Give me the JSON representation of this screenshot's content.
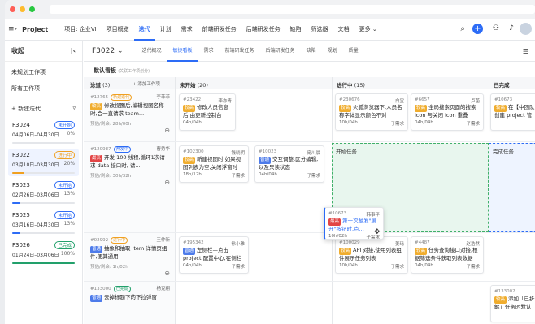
{
  "app": {
    "title": "Project",
    "project": "项目: 企业VI"
  },
  "nav": [
    "项目概览",
    "迭代",
    "计划",
    "需求",
    "前端研发任务",
    "后端研发任务",
    "缺陷",
    "筛选器",
    "文档",
    "更多"
  ],
  "sidebar": {
    "title": "收起",
    "links": [
      "未规划工作项",
      "所有工作项"
    ],
    "new_label": "新建迭代",
    "iterations": [
      {
        "name": "F3024",
        "dates": "04月06日–04月30日",
        "status": "未开始",
        "progress": "0%",
        "color": "#2d6cf6",
        "fill": 0
      },
      {
        "name": "F3022",
        "dates": "03月10日–03月30日",
        "status": "进行中",
        "progress": "20%",
        "color": "#f0a020",
        "fill": 0.2
      },
      {
        "name": "F3023",
        "dates": "02月26日–03月06日",
        "status": "未开始",
        "progress": "13%",
        "color": "#2d6cf6",
        "fill": 0.13
      },
      {
        "name": "F3025",
        "dates": "03月16日–04月30日",
        "status": "未开始",
        "progress": "13%",
        "color": "#2d6cf6",
        "fill": 0.13
      },
      {
        "name": "F3026",
        "dates": "01月24日–03月06日",
        "status": "已完成",
        "progress": "100%",
        "color": "#22a06b",
        "fill": 1
      }
    ]
  },
  "subnav": {
    "current": "F3022",
    "tabs": [
      "迭代概况",
      "敏捷看板",
      "需求",
      "前端研发任务",
      "后端研发任务",
      "缺陷",
      "规划",
      "质量"
    ]
  },
  "board": {
    "title": "默认看板",
    "hint": "(关联工作项划分)",
    "pool": "泳道",
    "pool_count": "(3)",
    "add": "+ 添加工作项",
    "cols": [
      {
        "name": "未开始",
        "count": "(20)"
      },
      {
        "name": "进行中",
        "count": "(15)"
      },
      {
        "name": "已完成",
        "count": ""
      }
    ],
    "lane_headers": [
      {
        "id": "#12765",
        "status": "新建迭代",
        "assignee": "李菲菲",
        "label": "较高",
        "title": "修改视图后,编辑视图名称时,会一直请求 team...",
        "meta": "预估/剩余: 28h/00h"
      },
      {
        "id": "#120987",
        "status": "开发中",
        "assignee": "曹秀华",
        "label": "最高",
        "title": "开发 100 线程,循环1次请求 data 接口时, 请...",
        "meta": "预估/剩余: 30h/32h"
      },
      {
        "id": "#02992",
        "status": "进行中",
        "assignee": "王仲新",
        "label": "普通",
        "title": "抽象和抽取 item 详情页组件,便其通用",
        "meta": "预估/剩余: 1h/02h"
      },
      {
        "id": "#133000",
        "status": "已完成",
        "assignee": "杨克翔",
        "label": "普通",
        "title": "去掉标题下的下拉弹窗",
        "meta": ""
      }
    ],
    "cards": [
      {
        "id": "#23422",
        "assignee": "李亦青",
        "label": "较高",
        "title": "修改人员信息后 由更新控制台",
        "hours": "04h/04h",
        "type": ""
      },
      {
        "id": "#230676",
        "assignee": "白宝",
        "label": "较高",
        "title": "火狐浏览器下,人员名称字体显示颜色不对",
        "hours": "10h/04h",
        "type": "子需求"
      },
      {
        "id": "#6657",
        "assignee": "卢菡",
        "label": "较高",
        "title": "全局搜索页面的搜索 icon 与关闭 icon 重叠",
        "hours": "04h/04h",
        "type": "子需求"
      },
      {
        "id": "#10673",
        "assignee": "",
        "label": "较高",
        "title": "在【中团队创建 project 管 理员权限",
        "hours": "",
        "type": ""
      },
      {
        "id": "#102300",
        "assignee": "钱晓明",
        "label": "较高",
        "title": "新建视图时,如果视图列表为空,关闭浮窗时",
        "hours": "18h/12h",
        "type": "子需求"
      },
      {
        "id": "#10023",
        "assignee": "庞川晨",
        "label": "普通",
        "title": "交互调整,区分编辑,以及只读状态",
        "hours": "04h/04h",
        "type": "子需求"
      },
      {
        "id": "#10673",
        "assignee": "韩事平",
        "label": "最高",
        "title": "第一次触发\"展开\"按钮时,点...",
        "hours": "10h/02h",
        "type": "子需求"
      },
      {
        "id": "#195342",
        "assignee": "徐小雅",
        "label": "普通",
        "title": "左侧栏—点击 project 配置中心,在侧栏滑选中",
        "hours": "04h/04h",
        "type": "子需求"
      },
      {
        "id": "#100029",
        "assignee": "姜玛",
        "label": "较高",
        "title": "API 对接,使用列表组件展示任务列表",
        "hours": "10h/04h",
        "type": "子需求"
      },
      {
        "id": "#4487",
        "assignee": "赵浩然",
        "label": "较高",
        "title": "任务查询接口对接,根据筛选条件获取列表数据",
        "hours": "04h/04h",
        "type": "子需求"
      },
      {
        "id": "#133002",
        "assignee": "",
        "label": "较高",
        "title": "添加「已拆解」任务时默认排选器",
        "hours": "",
        "type": ""
      }
    ],
    "drop_zones": [
      "开始任务",
      "完成任务"
    ]
  }
}
